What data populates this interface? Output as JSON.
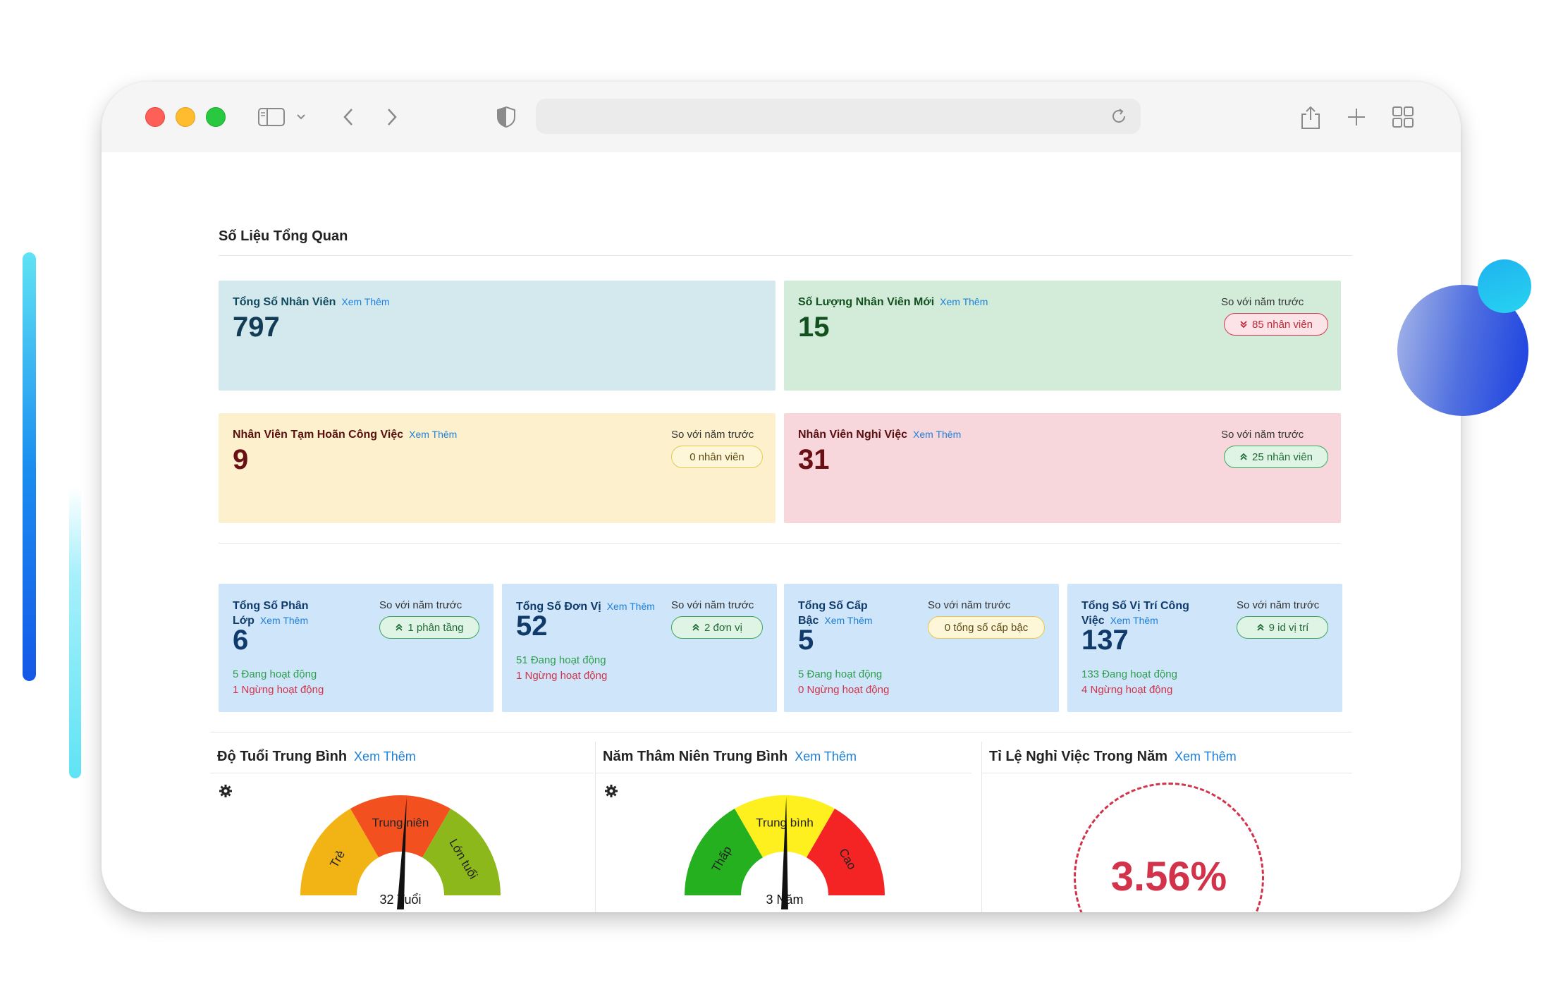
{
  "overview": {
    "title": "Số Liệu Tổng Quan",
    "compare_label": "So với năm trước",
    "more_label": "Xem Thêm"
  },
  "top_cards": [
    {
      "title": "Tổng Số Nhân Viên",
      "value": "797"
    },
    {
      "title": "Số Lượng Nhân Viên Mới",
      "value": "15",
      "compare": "85 nhân viên",
      "trend": "down"
    },
    {
      "title": "Nhân Viên Tạm Hoãn Công Việc",
      "value": "9",
      "compare": "0 nhân viên",
      "trend": "flat"
    },
    {
      "title": "Nhân Viên Nghỉ Việc",
      "value": "31",
      "compare": "25 nhân viên",
      "trend": "up"
    }
  ],
  "small_cards": [
    {
      "title": "Tổng Số Phân Lớp",
      "value": "6",
      "compare": "1 phân tầng",
      "trend": "up",
      "active": "5 Đang hoạt động",
      "inactive": "1 Ngừng hoạt động"
    },
    {
      "title": "Tổng Số Đơn Vị",
      "value": "52",
      "compare": "2 đơn vị",
      "trend": "up",
      "active": "51 Đang hoạt động",
      "inactive": "1 Ngừng hoạt động"
    },
    {
      "title": "Tổng Số Cấp Bậc",
      "value": "5",
      "compare": "0 tổng số cấp bậc",
      "trend": "flat",
      "active": "5 Đang hoạt động",
      "inactive": "0 Ngừng hoạt động"
    },
    {
      "title": "Tổng Số Vị Trí Công Việc",
      "value": "137",
      "compare": "9 id vị trí",
      "trend": "up",
      "active": "133 Đang hoạt động",
      "inactive": "4 Ngừng hoạt động"
    }
  ],
  "panels": [
    {
      "title": "Độ Tuổi Trung Bình",
      "gauge_value": "32 Tuổi",
      "segments": [
        "Trẻ",
        "Trung niên",
        "Lớn tuổi"
      ],
      "colors": [
        "#f2b414",
        "#f2501e",
        "#8db81c"
      ],
      "needle_fraction": 0.52
    },
    {
      "title": "Năm Thâm Niên Trung Bình",
      "gauge_value": "3 Năm",
      "segments": [
        "Thấp",
        "Trung bình",
        "Cao"
      ],
      "colors": [
        "#25b020",
        "#fef01e",
        "#f52424"
      ],
      "needle_fraction": 0.505
    },
    {
      "title": "Tỉ Lệ Nghỉ Việc Trong Năm",
      "rate": "3.56%"
    }
  ],
  "colors": {
    "link": "#1e7fd9",
    "rate": "#d2334a"
  }
}
